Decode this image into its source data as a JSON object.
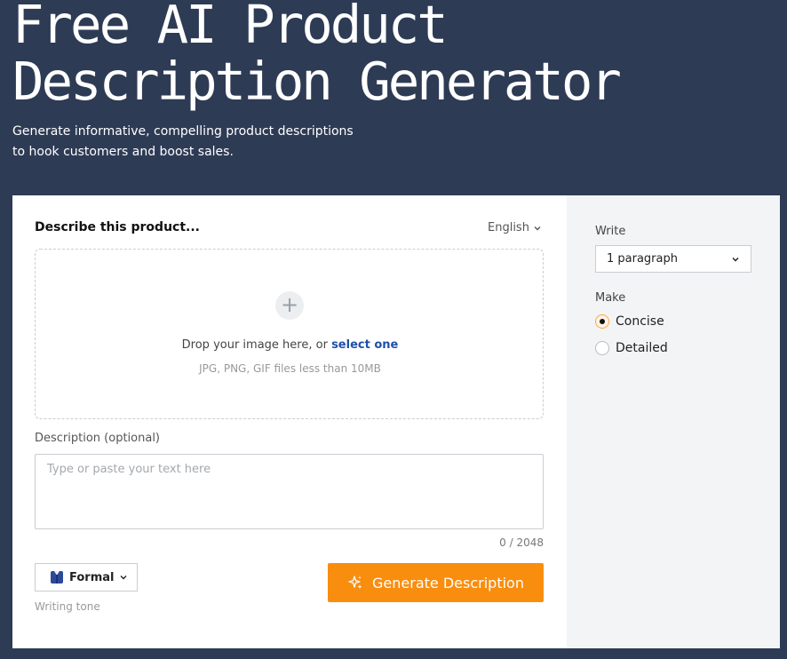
{
  "hero": {
    "title": "Free AI Product Description Generator",
    "subtitle": "Generate informative, compelling product descriptions to hook customers and boost sales."
  },
  "form": {
    "describe_label": "Describe this product...",
    "language": "English",
    "dropzone": {
      "text": "Drop your image here, or",
      "link": "select one",
      "hint": "JPG, PNG, GIF files less than 10MB",
      "icon": "plus-icon"
    },
    "description": {
      "label": "Description (optional)",
      "placeholder": "Type or paste your text here",
      "value": "",
      "counter": "0 / 2048"
    },
    "tone": {
      "value": "Formal",
      "caption": "Writing tone",
      "icon": "suit-icon"
    },
    "generate_button": "Generate Description"
  },
  "settings": {
    "write_label": "Write",
    "write_value": "1 paragraph",
    "make_label": "Make",
    "options": [
      {
        "label": "Concise",
        "checked": true
      },
      {
        "label": "Detailed",
        "checked": false
      }
    ]
  },
  "colors": {
    "page_bg": "#2e3b55",
    "accent": "#f98d0e",
    "link": "#1f4fa8",
    "panel_bg": "#f2f4f6"
  }
}
